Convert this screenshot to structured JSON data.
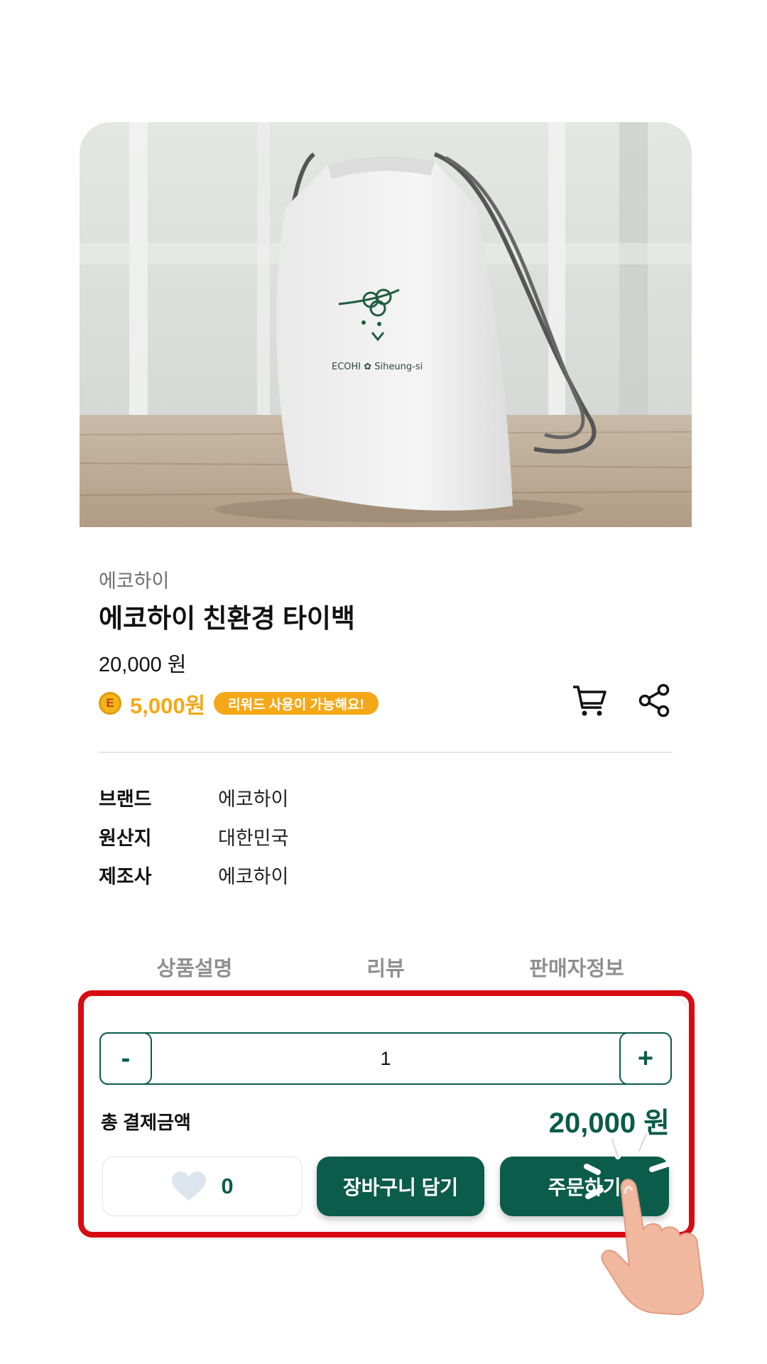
{
  "product": {
    "brand_label": "에코하이",
    "title": "에코하이 친환경 타이백",
    "price": "20,000 원",
    "image_alt": "ECOHI Siheung-si",
    "bag_print": "ECOHI ✿ Siheung-si"
  },
  "reward": {
    "coin_letter": "E",
    "amount": "5,000원",
    "badge": "리워드 사용이 가능해요!"
  },
  "icons": {
    "cart": "cart-icon",
    "share": "share-icon",
    "heart": "heart-icon",
    "coin": "reward-coin-icon",
    "hand": "tap-hand-icon"
  },
  "specs": [
    {
      "key": "브랜드",
      "value": "에코하이"
    },
    {
      "key": "원산지",
      "value": "대한민국"
    },
    {
      "key": "제조사",
      "value": "에코하이"
    }
  ],
  "tabs": [
    "상품설명",
    "리뷰",
    "판매자정보"
  ],
  "order": {
    "minus": "-",
    "quantity": "1",
    "plus": "+",
    "total_label": "총 결제금액",
    "total_amount": "20,000 원",
    "like_count": "0",
    "add_to_cart": "장바구니 담기",
    "order_now": "주문하기"
  },
  "colors": {
    "brand_green": "#0b5c4a",
    "reward_orange": "#f5a817",
    "highlight_red": "#d70c12",
    "heart_gray": "#dde5ef"
  }
}
